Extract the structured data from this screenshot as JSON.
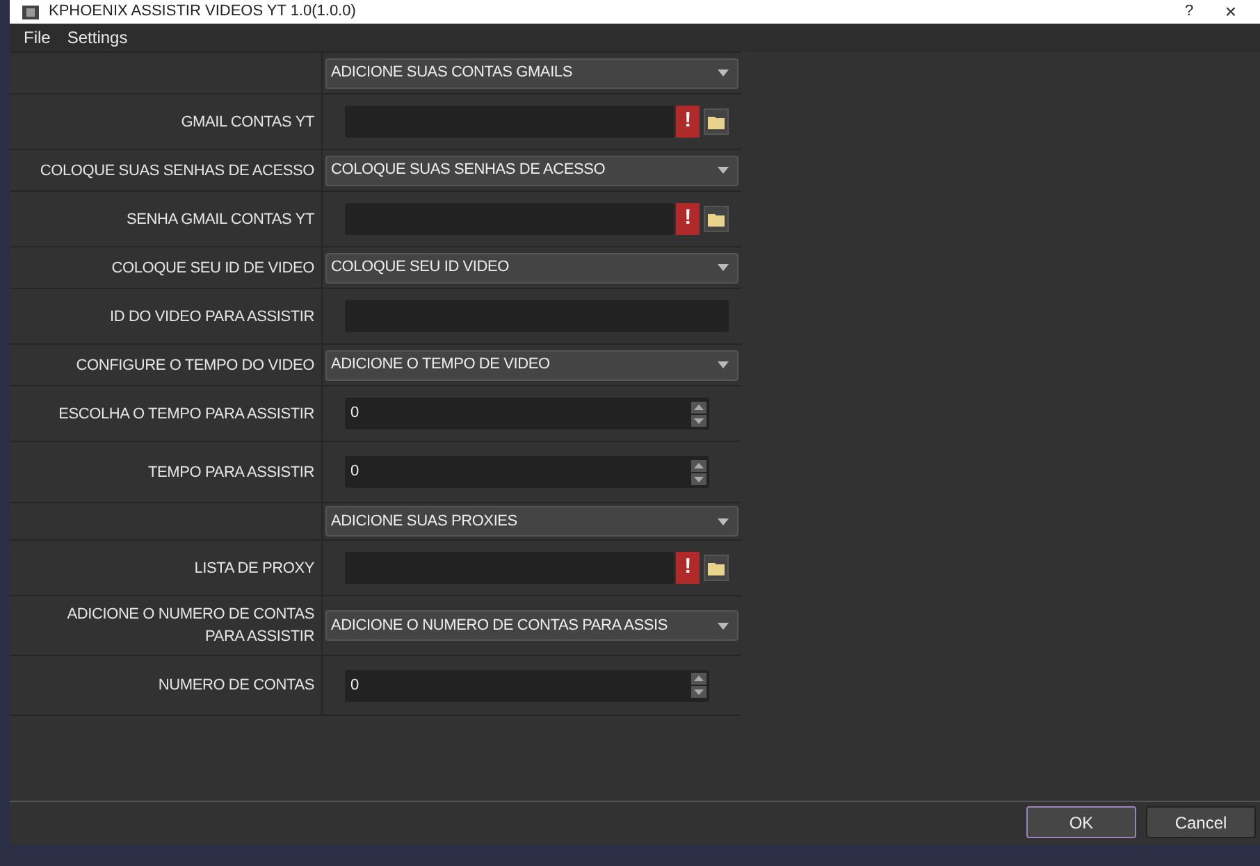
{
  "window": {
    "title": "KPHOENIX ASSISTIR VIDEOS YT 1.0(1.0.0)",
    "help": "?",
    "close": "×"
  },
  "menu": [
    "File",
    "Settings"
  ],
  "rows": [
    {
      "label": "",
      "kind": "combo",
      "value": "ADICIONE SUAS CONTAS GMAILS"
    },
    {
      "label": "GMAIL CONTAS YT",
      "kind": "file",
      "value": "",
      "warning": "!"
    },
    {
      "label": "COLOQUE SUAS SENHAS DE ACESSO",
      "kind": "combo",
      "value": "COLOQUE SUAS SENHAS DE ACESSO"
    },
    {
      "label": "SENHA GMAIL CONTAS YT",
      "kind": "file",
      "value": "",
      "warning": "!"
    },
    {
      "label": "COLOQUE SEU ID DE VIDEO",
      "kind": "combo",
      "value": "COLOQUE SEU ID VIDEO"
    },
    {
      "label": "ID DO VIDEO PARA ASSISTIR",
      "kind": "text",
      "value": ""
    },
    {
      "label": "CONFIGURE O TEMPO DO VIDEO",
      "kind": "combo",
      "value": "ADICIONE O TEMPO DE VIDEO"
    },
    {
      "label": "ESCOLHA O TEMPO PARA ASSISTIR",
      "kind": "spin",
      "value": "0"
    },
    {
      "label": "TEMPO PARA ASSISTIR",
      "kind": "spin",
      "value": "0"
    },
    {
      "label": "",
      "kind": "combo",
      "value": "ADICIONE SUAS PROXIES"
    },
    {
      "label": "LISTA DE PROXY",
      "kind": "file",
      "value": "",
      "warning": "!"
    },
    {
      "label": "ADICIONE O NUMERO DE CONTAS PARA ASSISTIR",
      "kind": "combo",
      "value": "ADICIONE O NUMERO DE CONTAS PARA ASSIS"
    },
    {
      "label": "NUMERO DE CONTAS",
      "kind": "spin",
      "value": "0"
    }
  ],
  "buttons": [
    {
      "label": "OK",
      "selected": true
    },
    {
      "label": "Cancel",
      "selected": false
    }
  ]
}
